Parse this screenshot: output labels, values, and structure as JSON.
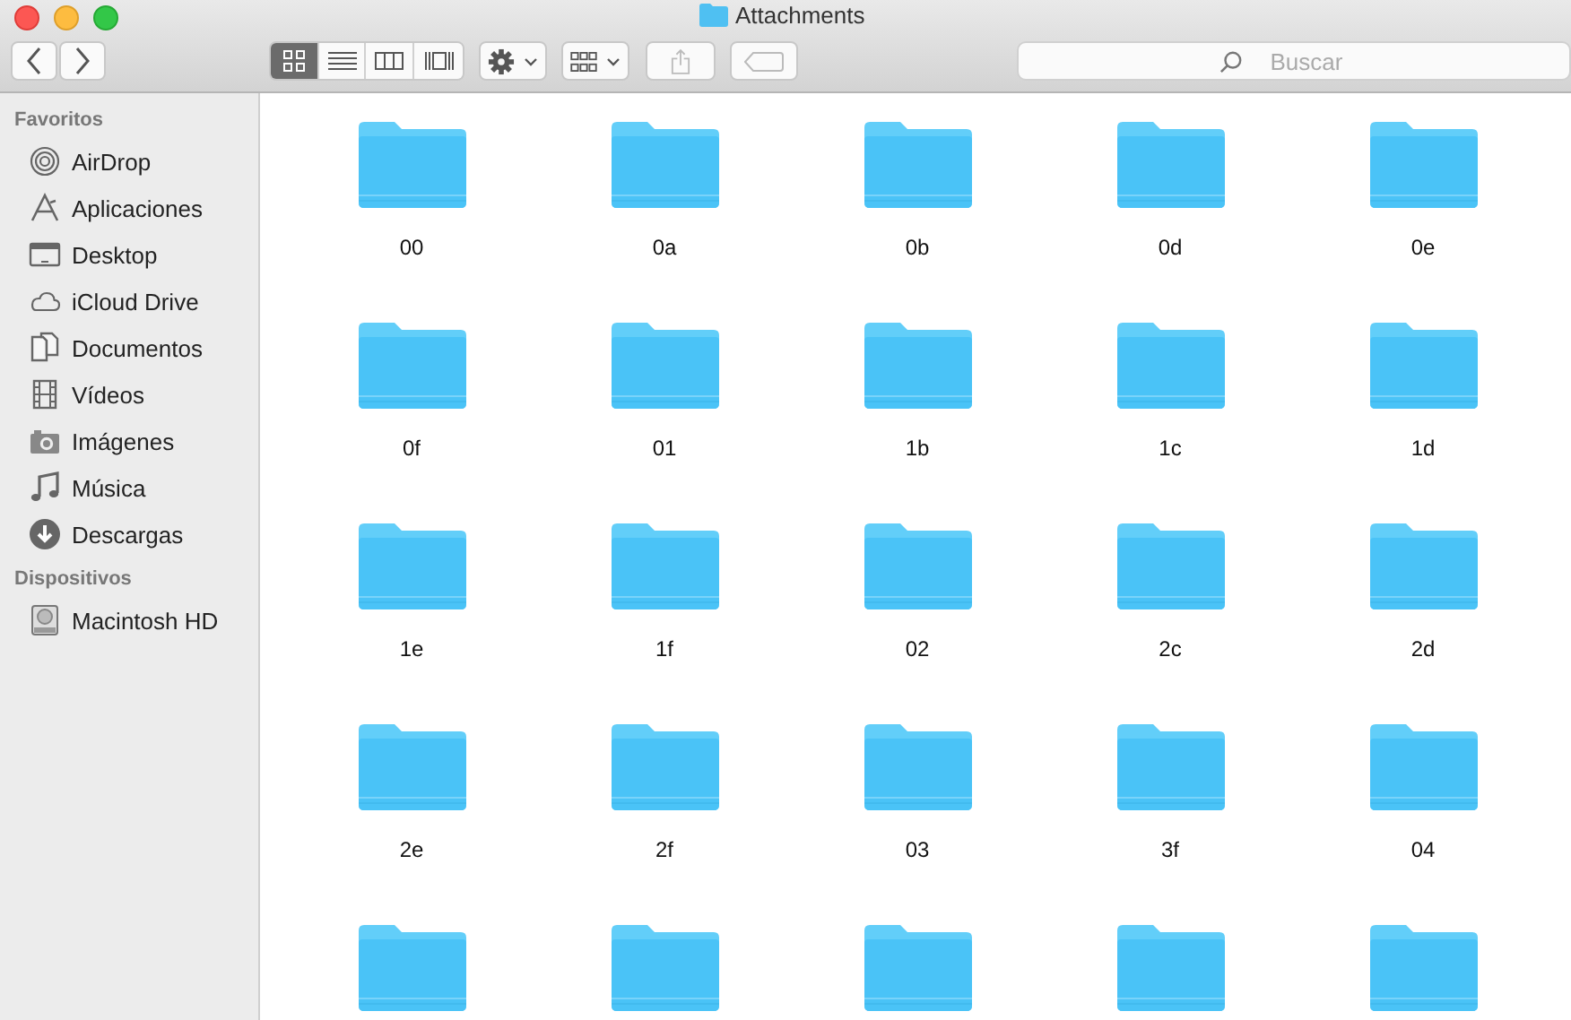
{
  "window": {
    "title": "Attachments"
  },
  "toolbar": {
    "view_buttons": [
      {
        "kind": "icons",
        "selected": true
      },
      {
        "kind": "list",
        "selected": false
      },
      {
        "kind": "columns",
        "selected": false
      },
      {
        "kind": "coverflow",
        "selected": false
      }
    ]
  },
  "search": {
    "placeholder": "Buscar"
  },
  "sidebar": {
    "sections": [
      {
        "title": "Favoritos",
        "items": [
          {
            "kind": "airdrop",
            "label": "AirDrop"
          },
          {
            "kind": "apps",
            "label": "Aplicaciones"
          },
          {
            "kind": "desktop",
            "label": "Desktop"
          },
          {
            "kind": "cloud",
            "label": "iCloud Drive"
          },
          {
            "kind": "documents",
            "label": "Documentos"
          },
          {
            "kind": "film",
            "label": "Vídeos"
          },
          {
            "kind": "camera",
            "label": "Imágenes"
          },
          {
            "kind": "music",
            "label": "Música"
          },
          {
            "kind": "download",
            "label": "Descargas"
          }
        ]
      },
      {
        "title": "Dispositivos",
        "items": [
          {
            "kind": "disk",
            "label": "Macintosh HD"
          }
        ]
      }
    ]
  },
  "folders": [
    {
      "kind": "folder",
      "name": "00"
    },
    {
      "kind": "folder",
      "name": "0a"
    },
    {
      "kind": "folder",
      "name": "0b"
    },
    {
      "kind": "folder",
      "name": "0d"
    },
    {
      "kind": "folder",
      "name": "0e"
    },
    {
      "kind": "folder",
      "name": "0f"
    },
    {
      "kind": "folder",
      "name": "01"
    },
    {
      "kind": "folder",
      "name": "1b"
    },
    {
      "kind": "folder",
      "name": "1c"
    },
    {
      "kind": "folder",
      "name": "1d"
    },
    {
      "kind": "folder",
      "name": "1e"
    },
    {
      "kind": "folder",
      "name": "1f"
    },
    {
      "kind": "folder",
      "name": "02"
    },
    {
      "kind": "folder",
      "name": "2c"
    },
    {
      "kind": "folder",
      "name": "2d"
    },
    {
      "kind": "folder",
      "name": "2e"
    },
    {
      "kind": "folder",
      "name": "2f"
    },
    {
      "kind": "folder",
      "name": "03"
    },
    {
      "kind": "folder",
      "name": "3f"
    },
    {
      "kind": "folder",
      "name": "04"
    },
    {
      "kind": "folder"
    },
    {
      "kind": "folder"
    },
    {
      "kind": "folder"
    },
    {
      "kind": "folder"
    },
    {
      "kind": "folder"
    }
  ]
}
